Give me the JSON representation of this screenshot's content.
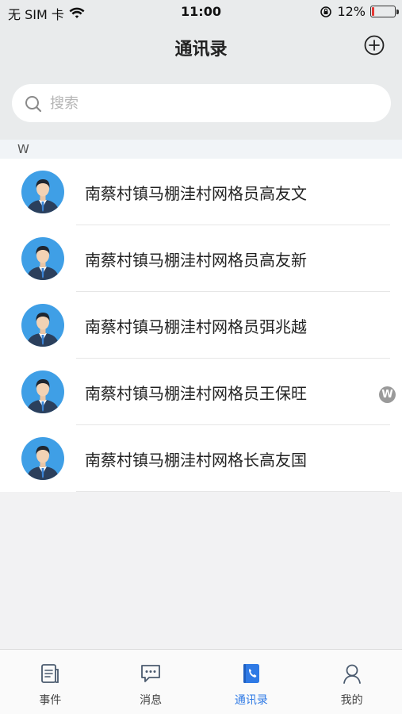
{
  "status_bar": {
    "carrier": "无 SIM 卡",
    "time": "11:00",
    "battery_percent": "12%",
    "battery_level": 0.12
  },
  "nav": {
    "title": "通讯录"
  },
  "search": {
    "placeholder": "搜索",
    "value": ""
  },
  "section": {
    "letter": "W"
  },
  "contacts": [
    {
      "name": "南蔡村镇马棚洼村网格员高友文"
    },
    {
      "name": "南蔡村镇马棚洼村网格员高友新"
    },
    {
      "name": "南蔡村镇马棚洼村网格员弭兆越"
    },
    {
      "name": "南蔡村镇马棚洼村网格员王保旺"
    },
    {
      "name": "南蔡村镇马棚洼村网格长高友国"
    }
  ],
  "index_bar": {
    "letter": "W"
  },
  "tabs": [
    {
      "label": "事件",
      "icon": "document-icon",
      "active": false
    },
    {
      "label": "消息",
      "icon": "chat-icon",
      "active": false
    },
    {
      "label": "通讯录",
      "icon": "contacts-book-icon",
      "active": true
    },
    {
      "label": "我的",
      "icon": "person-icon",
      "active": false
    }
  ],
  "colors": {
    "accent": "#2f7ae5",
    "battery_low": "#e53935"
  }
}
